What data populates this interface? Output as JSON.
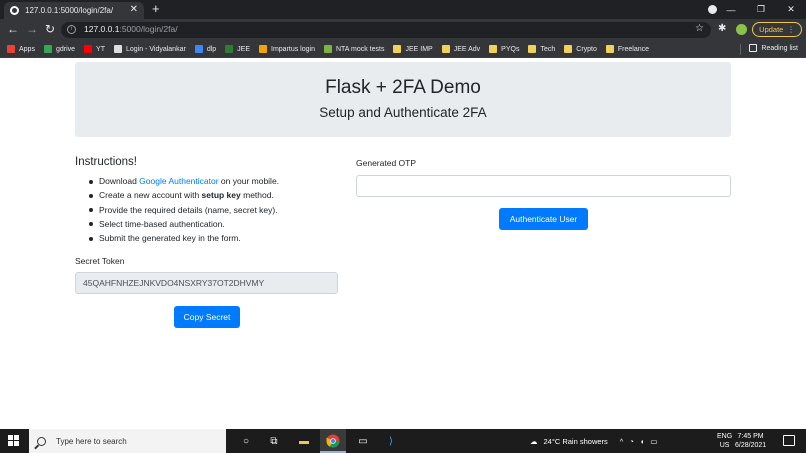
{
  "browser": {
    "tab_title": "127.0.0.1:5000/login/2fa/",
    "url_host": "127.0.0.1",
    "url_path": ":5000/login/2fa/",
    "update_label": "Update",
    "bookmarks": [
      {
        "label": "Apps",
        "color": "#ea4335"
      },
      {
        "label": "gdrive",
        "color": "#34a853"
      },
      {
        "label": "YT",
        "color": "#ff0000"
      },
      {
        "label": "Login - Vidyalankar",
        "color": "#dddddd"
      },
      {
        "label": "dlp",
        "color": "#4285f4"
      },
      {
        "label": "JEE",
        "color": "#2e7d32"
      },
      {
        "label": "Impartus login",
        "color": "#f4a300"
      },
      {
        "label": "NTA mock tests",
        "color": "#7cb342"
      },
      {
        "label": "JEE IMP",
        "color": "#f2d15b"
      },
      {
        "label": "JEE Adv",
        "color": "#f2d15b"
      },
      {
        "label": "PYQs",
        "color": "#f2d15b"
      },
      {
        "label": "Tech",
        "color": "#f2d15b"
      },
      {
        "label": "Crypto",
        "color": "#f2d15b"
      },
      {
        "label": "Freelance",
        "color": "#f2d15b"
      }
    ],
    "reading_list": "Reading list"
  },
  "header": {
    "title": "Flask + 2FA Demo",
    "subtitle": "Setup and Authenticate 2FA"
  },
  "instructions": {
    "title": "Instructions!",
    "step1_pre": "Download ",
    "step1_link": "Google Authenticator",
    "step1_post": " on your mobile.",
    "step2_pre": "Create a new account with ",
    "step2_bold": "setup key",
    "step2_post": " method.",
    "step3": "Provide the required details (name, secret key).",
    "step4": "Select time-based authentication.",
    "step5": "Submit the generated key in the form."
  },
  "secret": {
    "label": "Secret Token",
    "value": "45QAHFNHZEJNKVDO4NSXRY37OT2DHVMY",
    "copy_label": "Copy Secret"
  },
  "otp": {
    "label": "Generated OTP",
    "value": "",
    "submit_label": "Authenticate User"
  },
  "taskbar": {
    "search_placeholder": "Type here to search",
    "weather": "24°C  Rain showers",
    "lang_top": "ENG",
    "lang_bottom": "US",
    "time": "7:45 PM",
    "date": "6/28/2021"
  },
  "colors": {
    "primary": "#007bff",
    "jumbotron": "#e9ecef"
  }
}
